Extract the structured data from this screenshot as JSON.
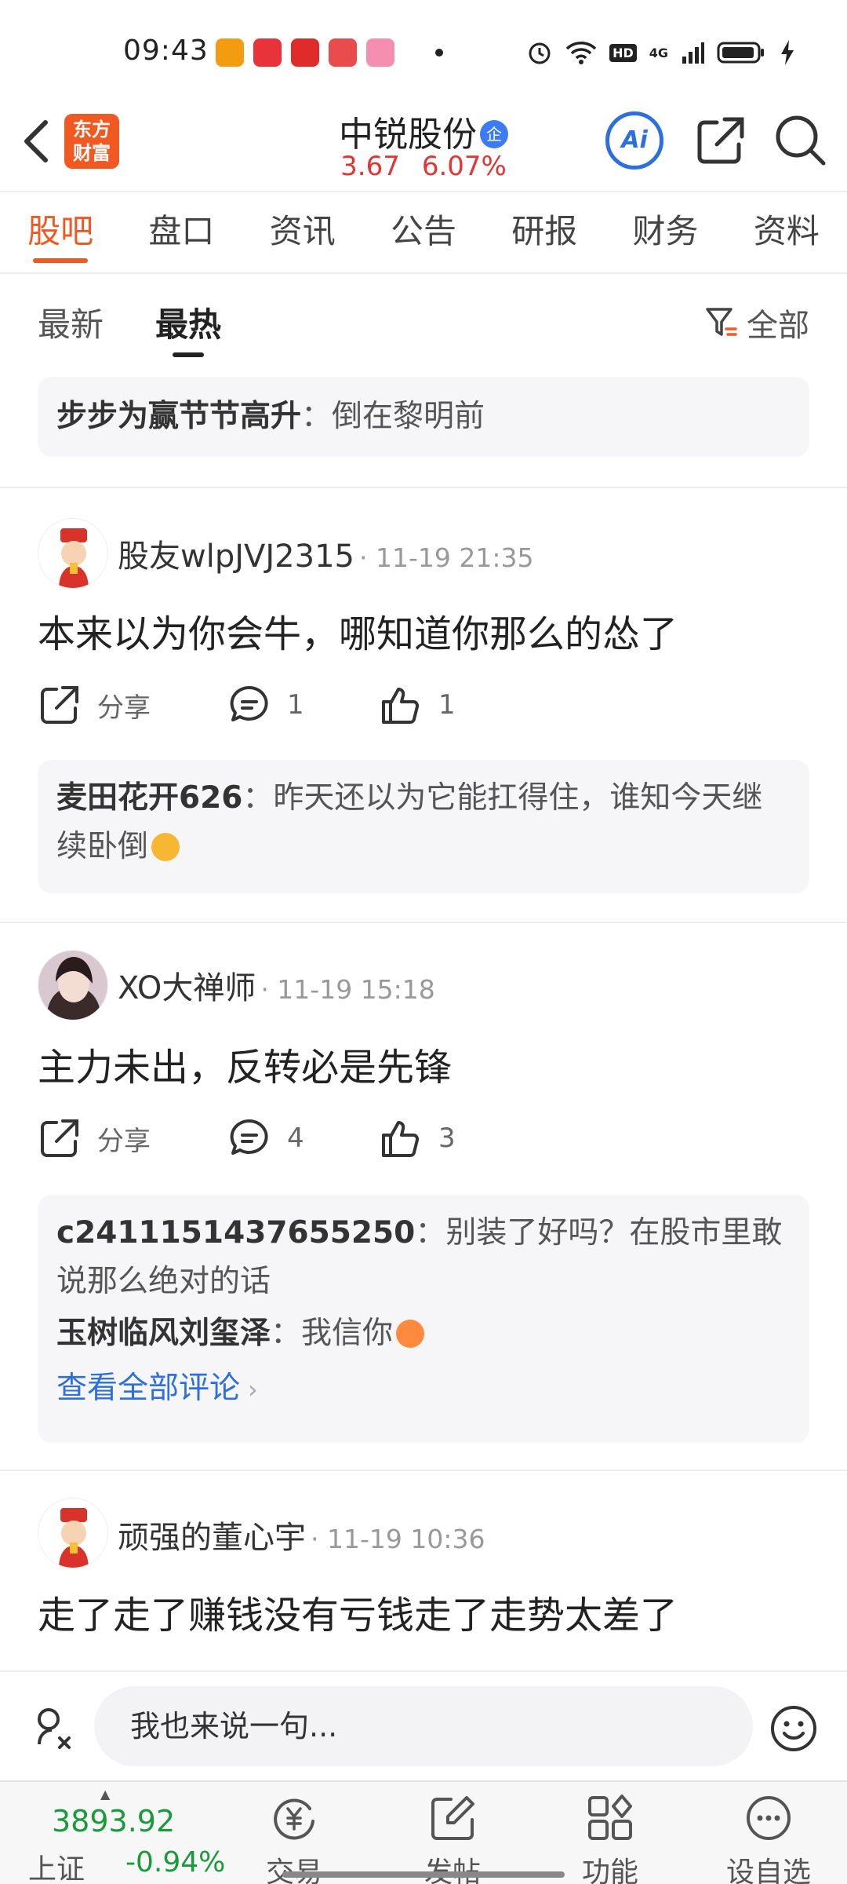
{
  "status_bar": {
    "time": "09:43",
    "network": "4G",
    "hd": "HD"
  },
  "header": {
    "logo_text": "东方财富",
    "stock_name": "中锐股份",
    "verified_badge": "企",
    "price": "3.67",
    "change_pct": "6.07%",
    "ai_label": "Ai"
  },
  "main_tabs": [
    "股吧",
    "盘口",
    "资讯",
    "公告",
    "研报",
    "财务",
    "资料"
  ],
  "sort": {
    "latest": "最新",
    "hottest": "最热",
    "filter_label": "全部"
  },
  "pinned_reply": {
    "user": "步步为赢节节高升",
    "text": "：倒在黎明前"
  },
  "posts": [
    {
      "author": "股友wlpJVJ2315",
      "time": "· 11-19 21:35",
      "text": "本来以为你会牛，哪知道你那么的怂了",
      "share": "分享",
      "comments": "1",
      "likes": "1",
      "replies": [
        {
          "user": "麦田花开626",
          "text": "：昨天还以为它能扛得住，谁知今天继续卧倒"
        }
      ]
    },
    {
      "author": "XO大禅师",
      "time": "· 11-19 15:18",
      "text": "主力未出，反转必是先锋",
      "share": "分享",
      "comments": "4",
      "likes": "3",
      "replies": [
        {
          "user": "c2411151437655250",
          "text": "：别装了好吗？在股市里敢说那么绝对的话"
        },
        {
          "user": "玉树临风刘玺泽",
          "text": "：我信你"
        }
      ],
      "view_all": "查看全部评论"
    },
    {
      "author": "顽强的董心宇",
      "time": "· 11-19 10:36",
      "text": "走了走了赚钱没有亏钱走了走势太差了"
    }
  ],
  "input": {
    "placeholder": "我也来说一句..."
  },
  "bottom_nav": {
    "index_value": "3893.92",
    "index_name": "上证",
    "index_change": "-0.94%",
    "items": [
      "交易",
      "发帖",
      "功能",
      "设自选"
    ]
  },
  "colors": {
    "accent": "#f05a22",
    "up": "#e23535",
    "down": "#1a9b3b",
    "link": "#2e6fe0"
  }
}
